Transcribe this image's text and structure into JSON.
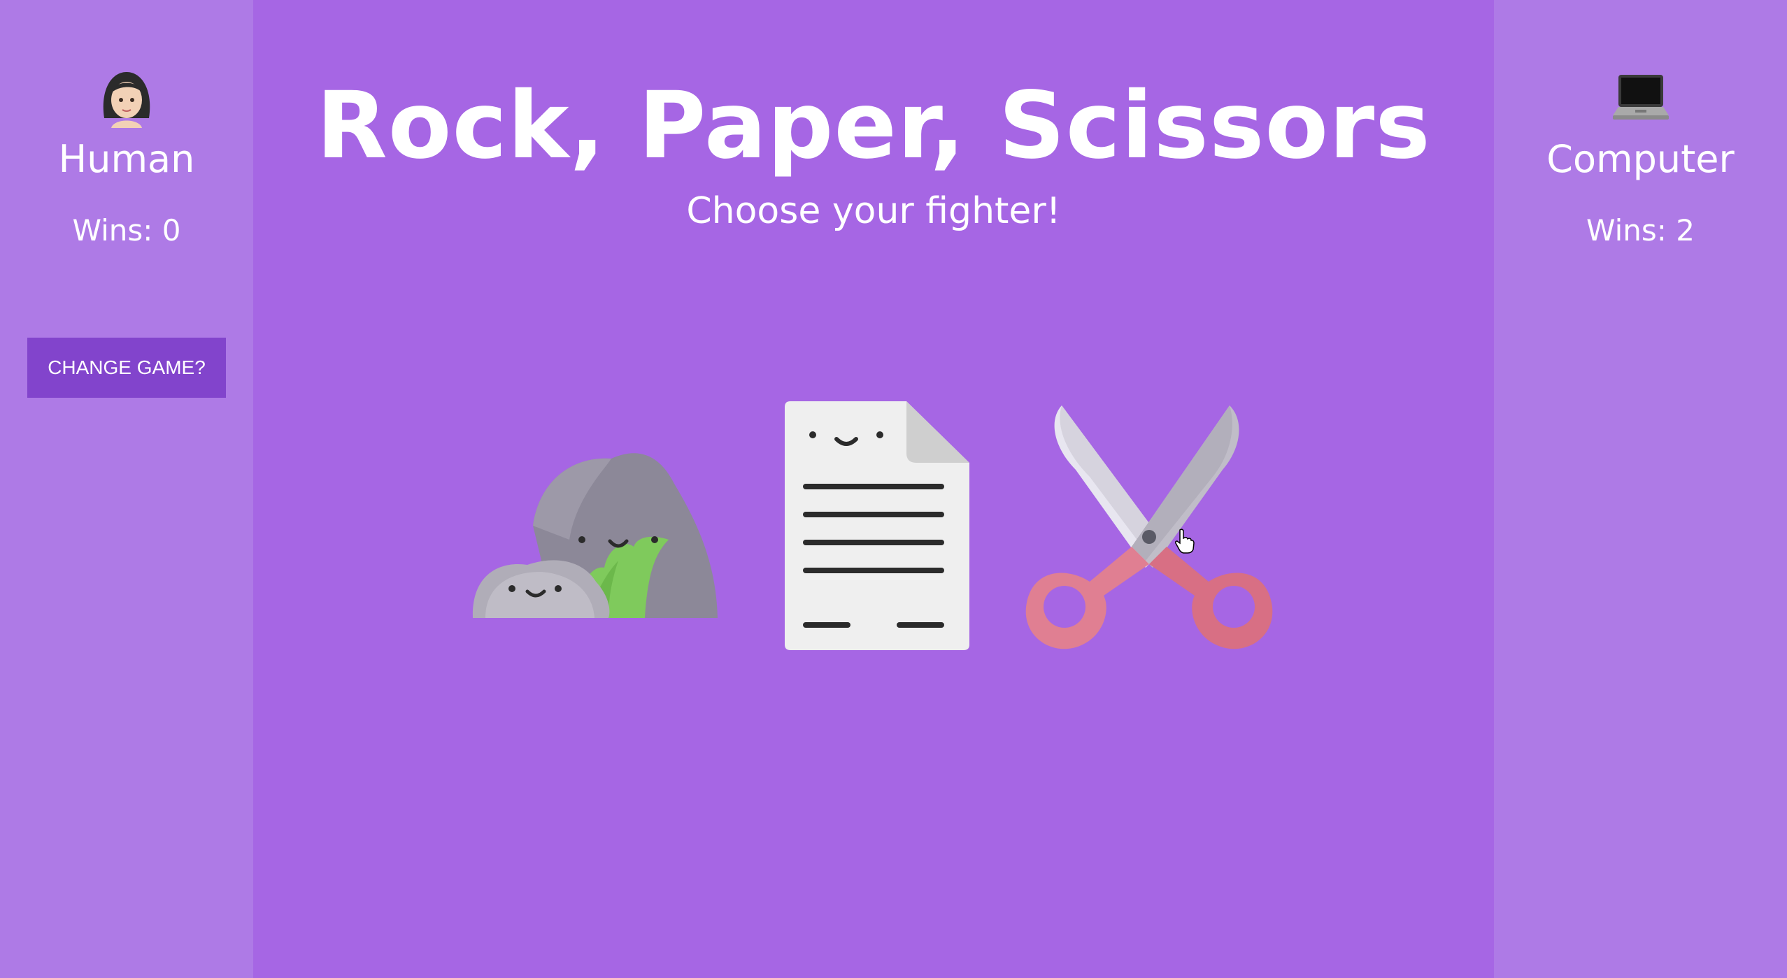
{
  "title": "Rock, Paper, Scissors",
  "subtitle": "Choose your fighter!",
  "human": {
    "avatar_icon": "woman-emoji-icon",
    "name": "Human",
    "wins_text": "Wins: 0",
    "wins": 0
  },
  "computer": {
    "avatar_icon": "laptop-emoji-icon",
    "name": "Computer",
    "wins_text": "Wins: 2",
    "wins": 2
  },
  "change_game_label": "CHANGE GAME?",
  "fighters": [
    {
      "name": "rock",
      "icon": "rock-icon"
    },
    {
      "name": "paper",
      "icon": "paper-icon"
    },
    {
      "name": "scissors",
      "icon": "scissors-icon"
    }
  ],
  "colors": {
    "background": "#a666e4",
    "sidebar": "#ae7ae6",
    "button": "#8244cc",
    "text": "#ffffff"
  }
}
